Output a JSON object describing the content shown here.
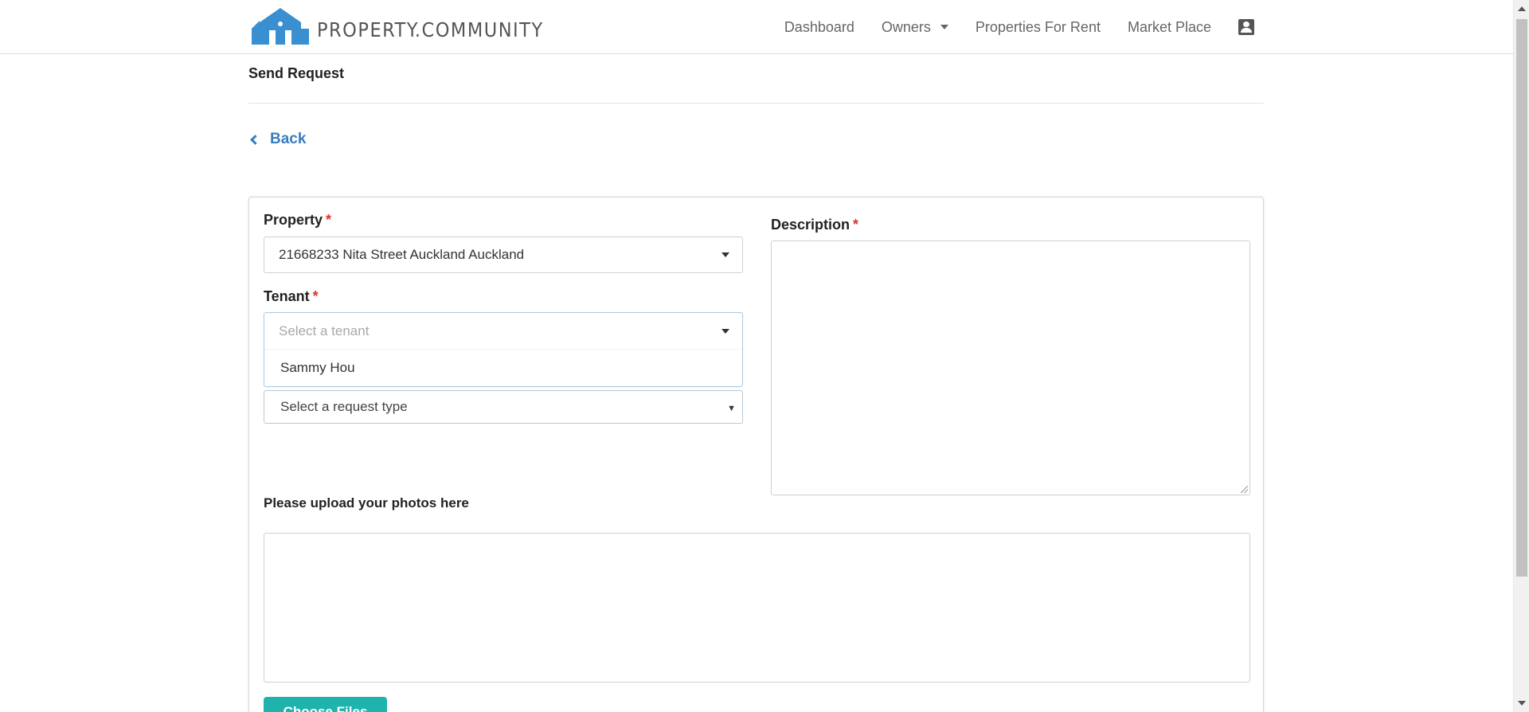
{
  "brand": {
    "name": "PROPERTY.COMMUNITY",
    "color": "#3a8fd1"
  },
  "nav": {
    "items": [
      {
        "label": "Dashboard"
      },
      {
        "label": "Owners"
      },
      {
        "label": "Properties For Rent"
      },
      {
        "label": "Market Place"
      }
    ],
    "user_icon": "contact-icon"
  },
  "page": {
    "title": "Send Request",
    "back_label": "Back"
  },
  "form": {
    "property": {
      "label": "Property",
      "required": "*",
      "value": "21668233 Nita Street Auckland Auckland"
    },
    "tenant": {
      "label": "Tenant",
      "required": "*",
      "placeholder": "Select a tenant",
      "options": [
        "Sammy Hou"
      ]
    },
    "request_type": {
      "placeholder": "Select a request type"
    },
    "description": {
      "label": "Description",
      "required": "*",
      "value": ""
    },
    "upload": {
      "label": "Please upload your photos here",
      "button_label": "Choose Files"
    }
  },
  "colors": {
    "accent": "#3a7dbf",
    "required": "#e0302a",
    "button": "#1fb3ad"
  }
}
